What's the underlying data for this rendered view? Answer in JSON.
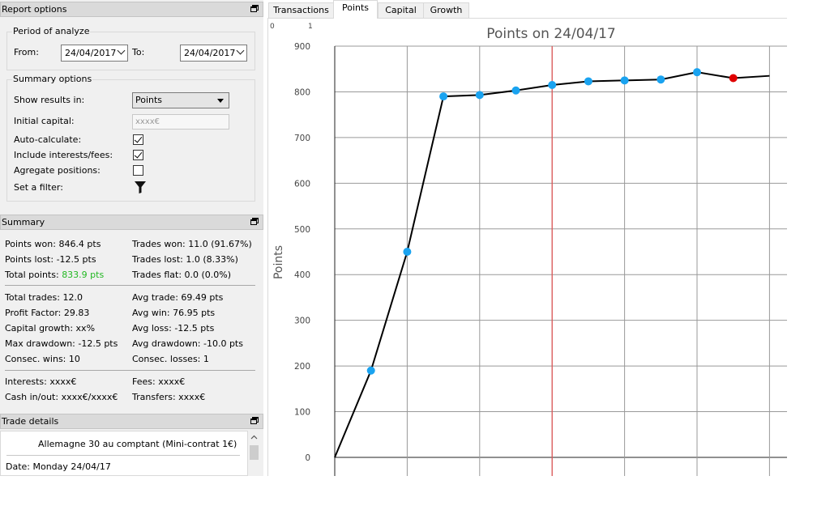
{
  "report_options": {
    "title": "Report options",
    "period": {
      "group_title": "Period of analyze",
      "from_label": "From:",
      "from_value": "24/04/2017",
      "to_label": "To:",
      "to_value": "24/04/2017"
    },
    "summary_options": {
      "group_title": "Summary options",
      "show_results_label": "Show results in:",
      "show_results_value": "Points",
      "initial_capital_label": "Initial capital:",
      "initial_capital_value": "xxxx€",
      "auto_calculate_label": "Auto-calculate:",
      "auto_calculate_checked": true,
      "include_interests_label": "Include interests/fees:",
      "include_interests_checked": true,
      "aggregate_label": "Agregate positions:",
      "aggregate_checked": false,
      "filter_label": "Set a filter:"
    }
  },
  "summary": {
    "title": "Summary",
    "points_won": "Points won: 846.4 pts",
    "points_lost": "Points lost: -12.5 pts",
    "total_points_label": "Total points: ",
    "total_points_value": "833.9 pts",
    "total_points_color": "#22b822",
    "trades_won": "Trades won: 11.0 (91.67%)",
    "trades_lost": "Trades lost: 1.0 (8.33%)",
    "trades_flat": "Trades flat: 0.0 (0.0%)",
    "total_trades": "Total trades: 12.0",
    "profit_factor": "Profit Factor: 29.83",
    "capital_growth": "Capital growth: xx%",
    "max_drawdown": "Max drawdown: -12.5 pts",
    "consec_wins": "Consec. wins: 10",
    "avg_trade": "Avg trade: 69.49 pts",
    "avg_win": "Avg win: 76.95 pts",
    "avg_loss": "Avg loss: -12.5 pts",
    "avg_drawdown": "Avg drawdown: -10.0 pts",
    "consec_losses": "Consec. losses: 1",
    "interests": "Interests: xxxx€",
    "cash_in_out": "Cash in/out: xxxx€/xxxx€",
    "fees": "Fees: xxxx€",
    "transfers": "Transfers: xxxx€"
  },
  "trade_details": {
    "title": "Trade details",
    "instrument": "Allemagne 30 au comptant (Mini-contrat 1€)",
    "date": "Date: Monday 24/04/17"
  },
  "tabs": [
    "Transactions",
    "Points",
    "Capital",
    "Growth"
  ],
  "active_tab": "Points",
  "chart_data": {
    "type": "line",
    "title": "Points on 24/04/17",
    "ylabel": "Points",
    "x_top_ticks": [
      "0",
      "1"
    ],
    "ylim": [
      0,
      900
    ],
    "yticks": [
      0,
      100,
      200,
      300,
      400,
      500,
      600,
      700,
      800,
      900
    ],
    "points": [
      0,
      190,
      450,
      790,
      793,
      803,
      815,
      823,
      825,
      827,
      843,
      830,
      835
    ],
    "highlight_index": 11,
    "marker_color": "#1aa3f0",
    "highlight_color": "#e00000",
    "line_color": "#000000",
    "vertical_marker_color": "#e05050",
    "vertical_marker_index": 6
  }
}
